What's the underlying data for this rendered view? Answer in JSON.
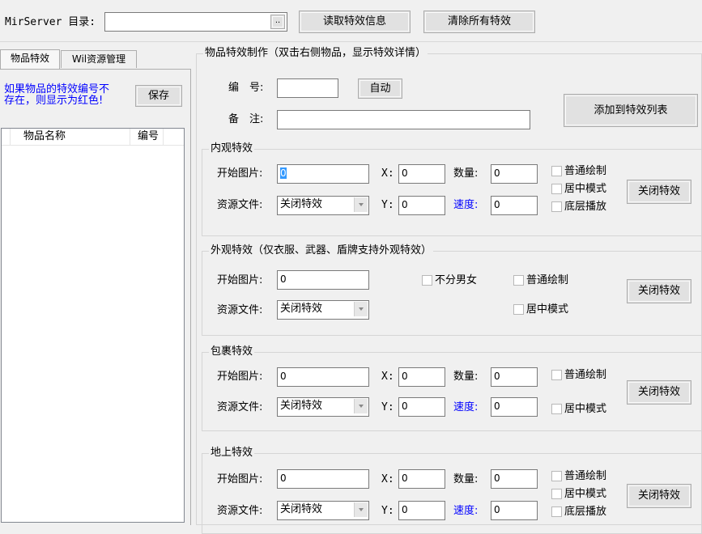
{
  "toolbar": {
    "dir_label": "MirServer 目录:",
    "dir_value": "",
    "browse_label": "..",
    "read_btn": "读取特效信息",
    "clear_btn": "清除所有特效"
  },
  "left": {
    "tabs": [
      "物品特效",
      "Wil资源管理"
    ],
    "hint": "如果物品的特效编号不存在，则显示为红色!",
    "hint_line1": "如果物品的特效编号不",
    "hint_line2": "存在，则显示为红色!",
    "save_btn": "保存",
    "columns": [
      "物品名称",
      "编号"
    ],
    "rows": []
  },
  "main": {
    "title": "物品特效制作（双击右侧物品，显示特效详情）",
    "number_label": "编　号:",
    "number_value": "",
    "auto_btn": "自动",
    "note_label": "备　注:",
    "note_value": "",
    "add_btn": "添加到特效列表"
  },
  "inner": {
    "title": "内观特效",
    "start_label": "开始图片:",
    "start_value": "0",
    "x_label": "X:",
    "x_value": "0",
    "count_label": "数量:",
    "count_value": "0",
    "res_label": "资源文件:",
    "res_value": "关闭特效",
    "y_label": "Y:",
    "y_value": "0",
    "speed_label": "速度:",
    "speed_value": "0",
    "cb_normal": "普通绘制",
    "cb_center": "居中模式",
    "cb_bottom": "底层播放",
    "close_btn": "关闭特效"
  },
  "outer": {
    "title": "外观特效（仅衣服、武器、盾牌支持外观特效）",
    "start_label": "开始图片:",
    "start_value": "0",
    "res_label": "资源文件:",
    "res_value": "关闭特效",
    "cb_gender": "不分男女",
    "cb_normal": "普通绘制",
    "cb_center": "居中模式",
    "close_btn": "关闭特效"
  },
  "bag": {
    "title": "包裹特效",
    "start_label": "开始图片:",
    "start_value": "0",
    "x_label": "X:",
    "x_value": "0",
    "count_label": "数量:",
    "count_value": "0",
    "res_label": "资源文件:",
    "res_value": "关闭特效",
    "y_label": "Y:",
    "y_value": "0",
    "speed_label": "速度:",
    "speed_value": "0",
    "cb_normal": "普通绘制",
    "cb_center": "居中模式",
    "close_btn": "关闭特效"
  },
  "ground": {
    "title": "地上特效",
    "start_label": "开始图片:",
    "start_value": "0",
    "x_label": "X:",
    "x_value": "0",
    "count_label": "数量:",
    "count_value": "0",
    "res_label": "资源文件:",
    "res_value": "关闭特效",
    "y_label": "Y:",
    "y_value": "0",
    "speed_label": "速度:",
    "speed_value": "0",
    "cb_normal": "普通绘制",
    "cb_center": "居中模式",
    "cb_bottom": "底层播放",
    "close_btn": "关闭特效"
  },
  "colors": {
    "hint": "#0000ff",
    "speed_label": "#0000ff",
    "selection": "#3399ff"
  }
}
